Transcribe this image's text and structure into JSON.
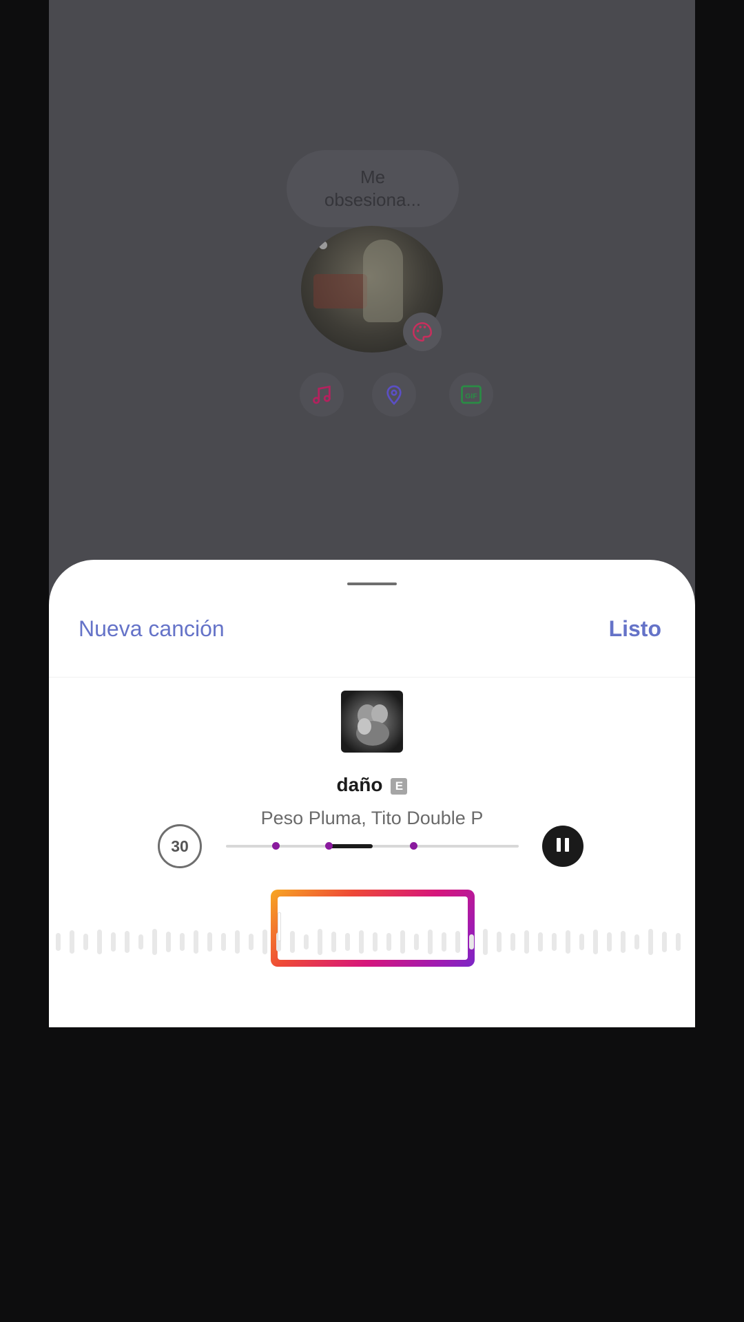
{
  "background": {
    "note_text": "Me\nobsesiona...",
    "tools": [
      {
        "icon": "music-note-icon",
        "color": "#c2185b"
      },
      {
        "icon": "location-pin-icon",
        "color": "#6a5acd"
      },
      {
        "icon": "gif-icon",
        "color": "#2e9a4c"
      }
    ]
  },
  "sheet": {
    "left_action": "Nueva canción",
    "right_action": "Listo",
    "accent": "#6573c8"
  },
  "song": {
    "title": "daño",
    "explicit_badge": "E",
    "artists": "Peso Pluma, Tito Double P",
    "duration": "30",
    "progress_markers": [
      0.17,
      0.35,
      0.64
    ],
    "played_range": [
      0.35,
      0.5
    ],
    "controls": {
      "play_state": "playing",
      "icon": "pause-icon"
    }
  },
  "waveform": {
    "selection_gradient": [
      "#f7a823",
      "#ee4a36",
      "#d6167b",
      "#a11bb0",
      "#7a27c7"
    ]
  }
}
